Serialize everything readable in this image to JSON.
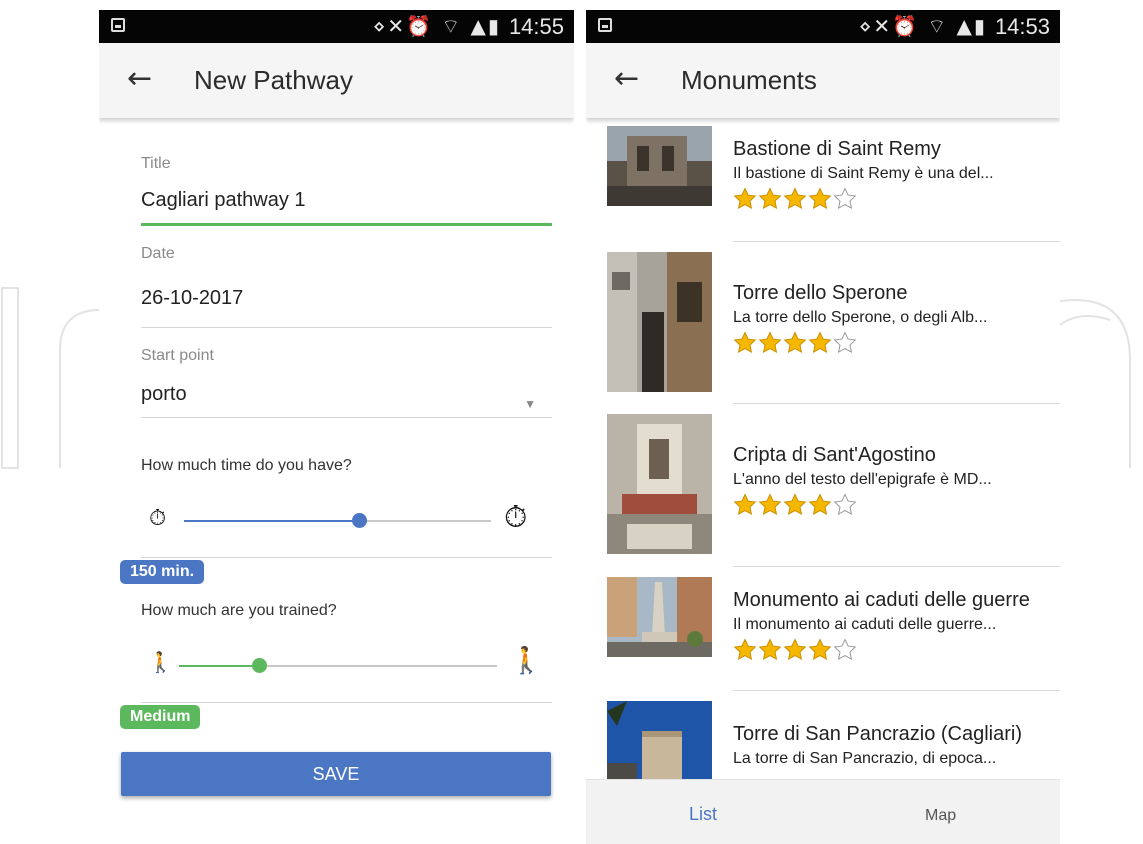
{
  "left_screen": {
    "status": {
      "time": "14:55",
      "icons": "⋄✕⏰ ⌔ ▲▮"
    },
    "appbar": {
      "title": "New Pathway"
    },
    "form": {
      "title_label": "Title",
      "title_value": "Cagliari pathway 1",
      "date_label": "Date",
      "date_value": "26-10-2017",
      "start_label": "Start point",
      "start_value": "porto",
      "time_question": "How much time do you have?",
      "time_badge": "150 min.",
      "time_level": 0.57,
      "train_question": "How much are you trained?",
      "train_badge": "Medium",
      "train_level": 0.25,
      "save_label": "SAVE"
    },
    "colors": {
      "time_slider": "#4a76c4",
      "train_slider": "#5cb85c",
      "accent_green": "#5cb85c"
    }
  },
  "right_screen": {
    "status": {
      "time": "14:53",
      "icons": "⋄✕⏰ ⌔ ▲▮"
    },
    "appbar": {
      "title": "Monuments"
    },
    "items": [
      {
        "title": "Bastione di Saint Remy",
        "subtitle": "Il bastione di Saint Remy è una del...",
        "rating": 4,
        "max_rating": 5
      },
      {
        "title": "Torre dello Sperone",
        "subtitle": "La torre dello Sperone, o degli Alb...",
        "rating": 4,
        "max_rating": 5
      },
      {
        "title": "Cripta di Sant'Agostino",
        "subtitle": "L'anno del testo dell'epigrafe è MD...",
        "rating": 4,
        "max_rating": 5
      },
      {
        "title": "Monumento ai caduti delle guerre",
        "subtitle": "Il monumento ai caduti delle guerre...",
        "rating": 4,
        "max_rating": 5
      },
      {
        "title": "Torre di San Pancrazio (Cagliari)",
        "subtitle": "La torre di San Pancrazio, di epoca...",
        "rating": null,
        "max_rating": 5
      }
    ],
    "tabs": {
      "list": "List",
      "map": "Map"
    },
    "colors": {
      "active_tab": "#4a76c4",
      "star_fill": "#f5b700"
    }
  }
}
